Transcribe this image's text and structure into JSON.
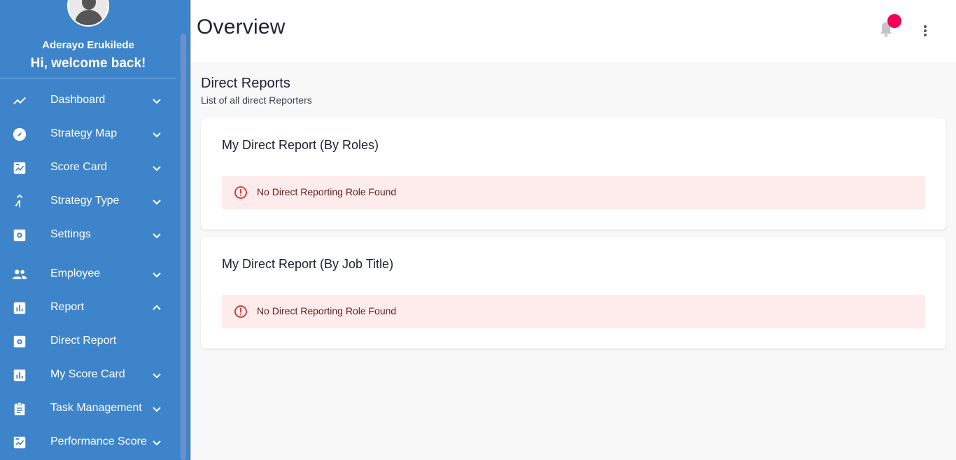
{
  "user": {
    "name": "Aderayo Erukilede",
    "greeting": "Hi, welcome back!"
  },
  "sidebar": {
    "items": [
      {
        "label": "Dashboard",
        "icon": "trending-up-icon",
        "chevron": "down"
      },
      {
        "label": "Strategy Map",
        "icon": "compass-icon",
        "chevron": "down"
      },
      {
        "label": "Score Card",
        "icon": "scorecard-icon",
        "chevron": "down"
      },
      {
        "label": "Strategy Type",
        "icon": "merge-icon",
        "chevron": "down"
      },
      {
        "label": "Settings",
        "icon": "settings-icon",
        "chevron": "down"
      },
      {
        "label": "Employee",
        "icon": "people-icon",
        "chevron": "down"
      },
      {
        "label": "Report",
        "icon": "bar-chart-icon",
        "chevron": "up"
      },
      {
        "label": "Direct Report",
        "icon": "settings-icon",
        "chevron": "none"
      },
      {
        "label": "My Score Card",
        "icon": "bar-chart-icon",
        "chevron": "down"
      },
      {
        "label": "Task Management",
        "icon": "clipboard-icon",
        "chevron": "down"
      },
      {
        "label": "Performance Score",
        "icon": "scorecard-icon",
        "chevron": "down"
      }
    ]
  },
  "header": {
    "title": "Overview"
  },
  "main": {
    "title": "Direct Reports",
    "subtitle": "List of all direct Reporters",
    "cards": [
      {
        "title": "My Direct Report (By Roles)",
        "alert": "No Direct Reporting Role Found"
      },
      {
        "title": "My Direct Report (By Job Title)",
        "alert": "No Direct Reporting Role Found"
      }
    ]
  },
  "colors": {
    "sidebar": "#3e84cb",
    "alert_bg": "#fdeceb",
    "alert_icon": "#d32f2f",
    "badge": "#f50057"
  }
}
